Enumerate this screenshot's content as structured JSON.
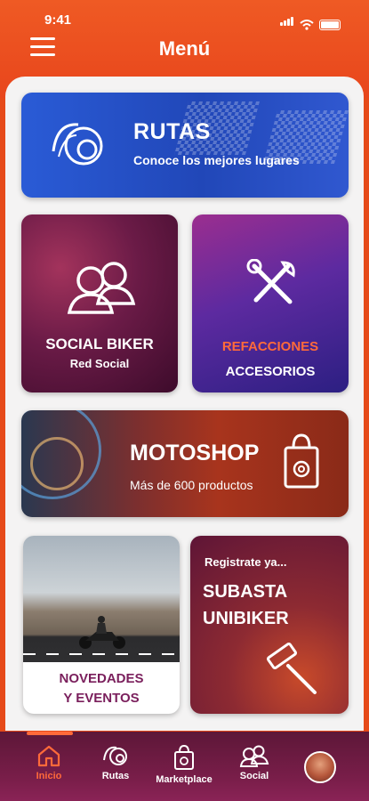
{
  "status_bar": {
    "time": "9:41"
  },
  "header": {
    "title": "Menú"
  },
  "cards": {
    "rutas": {
      "title": "RUTAS",
      "subtitle": "Conoce los mejores lugares"
    },
    "social": {
      "title": "SOCIAL BIKER",
      "subtitle": "Red Social"
    },
    "refacciones": {
      "title": "REFACCIONES",
      "subtitle": "ACCESORIOS"
    },
    "motoshop": {
      "title": "MOTOSHOP",
      "subtitle": "Más de 600 productos"
    },
    "novedades": {
      "line1": "NOVEDADES",
      "line2": "Y EVENTOS"
    },
    "subasta": {
      "pre": "Registrate ya...",
      "line1": "SUBASTA",
      "line2": "UNIBIKER"
    }
  },
  "tabbar": {
    "active_index": 0,
    "items": [
      {
        "label": "Inicio",
        "icon": "home-icon"
      },
      {
        "label": "Rutas",
        "icon": "routes-icon"
      },
      {
        "label": "Marketplace",
        "icon": "bag-icon"
      },
      {
        "label": "Social",
        "icon": "people-icon"
      }
    ]
  },
  "colors": {
    "brand_orange": "#e8461c",
    "accent": "#ff6a3a",
    "tabbar": "#6b1a40"
  }
}
